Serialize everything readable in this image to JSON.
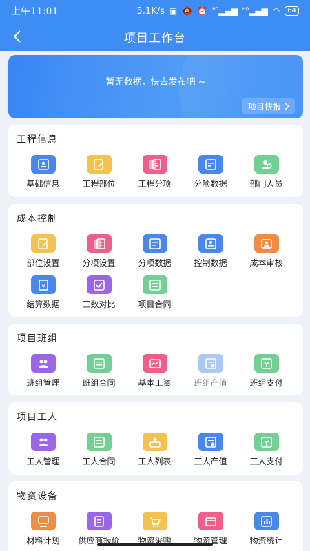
{
  "status": {
    "time": "上午11:01",
    "speed": "5.1K/s",
    "net1": "HD",
    "net2": "HD",
    "battery": "64"
  },
  "header": {
    "title": "项目工作台"
  },
  "banner": {
    "empty_text": "暂无数据，快去发布吧 ~",
    "quick_label": "项目快报"
  },
  "sections": [
    {
      "title": "工程信息",
      "items": [
        {
          "label": "基础信息",
          "icon": "id-card-icon",
          "color": "#4a87ea"
        },
        {
          "label": "工程部位",
          "icon": "edit-doc-icon",
          "color": "#f3c24f"
        },
        {
          "label": "工程分项",
          "icon": "list-doc-icon",
          "color": "#ef5f8a"
        },
        {
          "label": "分项数据",
          "icon": "data-doc-icon",
          "color": "#4a87ea"
        },
        {
          "label": "部门人员",
          "icon": "people-icon",
          "color": "#74cf95"
        }
      ]
    },
    {
      "title": "成本控制",
      "items": [
        {
          "label": "部位设置",
          "icon": "edit-doc-icon",
          "color": "#f3c24f"
        },
        {
          "label": "分项设置",
          "icon": "list-doc-icon",
          "color": "#ef5f8a"
        },
        {
          "label": "分项数据",
          "icon": "data-doc-icon",
          "color": "#4a87ea"
        },
        {
          "label": "控制数据",
          "icon": "id-card-icon",
          "color": "#4a87ea"
        },
        {
          "label": "成本审核",
          "icon": "person-card-icon",
          "color": "#f08c43"
        },
        {
          "label": "结算数据",
          "icon": "settle-icon",
          "color": "#4a87ea"
        },
        {
          "label": "三数对比",
          "icon": "compare-icon",
          "color": "#9b66e6"
        },
        {
          "label": "项目合同",
          "icon": "contract-icon",
          "color": "#74cf95"
        }
      ]
    },
    {
      "title": "项目班组",
      "items": [
        {
          "label": "班组管理",
          "icon": "team-icon",
          "color": "#9b66e6"
        },
        {
          "label": "班组合同",
          "icon": "contract-icon",
          "color": "#74cf95"
        },
        {
          "label": "基本工资",
          "icon": "wage-icon",
          "color": "#ef5f8a"
        },
        {
          "label": "班组产值",
          "icon": "output-icon",
          "color": "#4a87ea",
          "dim": true
        },
        {
          "label": "班组支付",
          "icon": "payment-icon",
          "color": "#74cf95"
        }
      ]
    },
    {
      "title": "项目工人",
      "items": [
        {
          "label": "工人管理",
          "icon": "team-icon",
          "color": "#9b66e6"
        },
        {
          "label": "工人合同",
          "icon": "contract-icon",
          "color": "#74cf95"
        },
        {
          "label": "工人列表",
          "icon": "worker-list-icon",
          "color": "#f3c24f"
        },
        {
          "label": "工人产值",
          "icon": "output-icon",
          "color": "#4a87ea"
        },
        {
          "label": "工人支付",
          "icon": "payment-icon",
          "color": "#74cf95"
        }
      ]
    },
    {
      "title": "物资设备",
      "items": [
        {
          "label": "材料计划",
          "icon": "plan-icon",
          "color": "#f08c43"
        },
        {
          "label": "供应商报价",
          "icon": "quote-icon",
          "color": "#9b66e6"
        },
        {
          "label": "物资采购",
          "icon": "purchase-icon",
          "color": "#f3c24f"
        },
        {
          "label": "物资管理",
          "icon": "material-icon",
          "color": "#ef5f8a"
        },
        {
          "label": "物资统计",
          "icon": "stats-icon",
          "color": "#4a87ea"
        }
      ]
    }
  ]
}
